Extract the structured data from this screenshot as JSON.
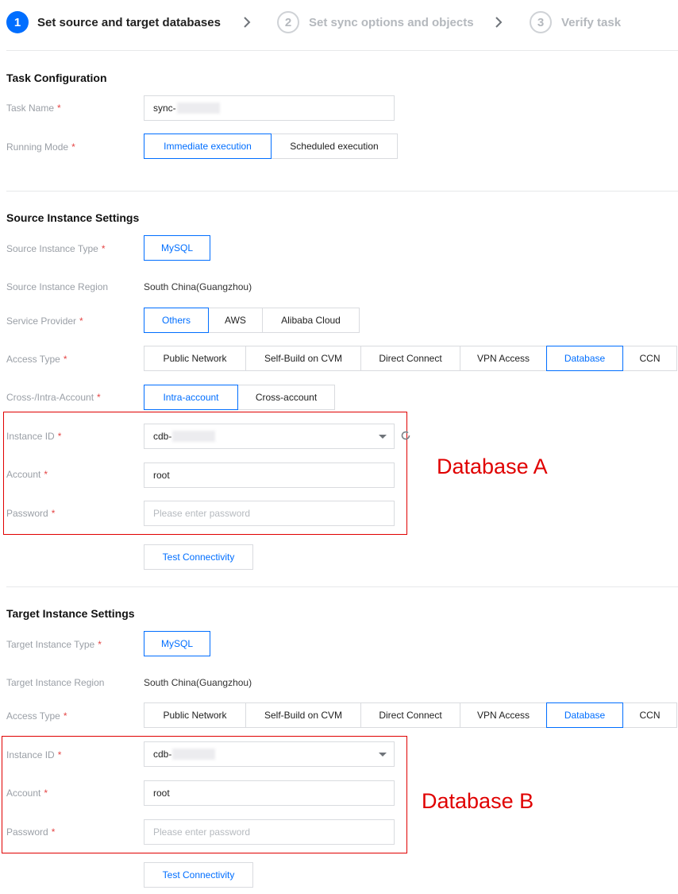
{
  "steps": [
    {
      "num": "1",
      "label": "Set source and target databases"
    },
    {
      "num": "2",
      "label": "Set sync options and objects"
    },
    {
      "num": "3",
      "label": "Verify task"
    }
  ],
  "task_config": {
    "title": "Task Configuration",
    "task_name_label": "Task Name",
    "task_name_value": "sync-",
    "running_mode_label": "Running Mode",
    "running_modes": [
      "Immediate execution",
      "Scheduled execution"
    ],
    "running_mode_selected": "Immediate execution"
  },
  "source": {
    "title": "Source Instance Settings",
    "type_label": "Source Instance Type",
    "type_value": "MySQL",
    "region_label": "Source Instance Region",
    "region_value": "South China(Guangzhou)",
    "provider_label": "Service Provider",
    "providers": [
      "Others",
      "AWS",
      "Alibaba Cloud"
    ],
    "provider_selected": "Others",
    "access_label": "Access Type",
    "access_types": [
      "Public Network",
      "Self-Build on CVM",
      "Direct Connect",
      "VPN Access",
      "Database",
      "CCN"
    ],
    "access_selected": "Database",
    "account_scope_label": "Cross-/Intra-Account",
    "account_scopes": [
      "Intra-account",
      "Cross-account"
    ],
    "account_scope_selected": "Intra-account",
    "instance_id_label": "Instance ID",
    "instance_id_value": "cdb-",
    "account_label": "Account",
    "account_value": "root",
    "password_label": "Password",
    "password_placeholder": "Please enter password",
    "test_button": "Test Connectivity",
    "annotation": "Database A"
  },
  "target": {
    "title": "Target Instance Settings",
    "type_label": "Target Instance Type",
    "type_value": "MySQL",
    "region_label": "Target Instance Region",
    "region_value": "South China(Guangzhou)",
    "access_label": "Access Type",
    "access_types": [
      "Public Network",
      "Self-Build on CVM",
      "Direct Connect",
      "VPN Access",
      "Database",
      "CCN"
    ],
    "access_selected": "Database",
    "instance_id_label": "Instance ID",
    "instance_id_value": "cdb-",
    "account_label": "Account",
    "account_value": "root",
    "password_label": "Password",
    "password_placeholder": "Please enter password",
    "test_button": "Test Connectivity",
    "annotation": "Database B"
  },
  "required_mark": "*",
  "colors": {
    "accent": "#006eff",
    "required": "#e54545",
    "annotation": "#e00000"
  },
  "icons": [
    "chevron-right-icon",
    "refresh-icon",
    "chevron-down-icon"
  ]
}
